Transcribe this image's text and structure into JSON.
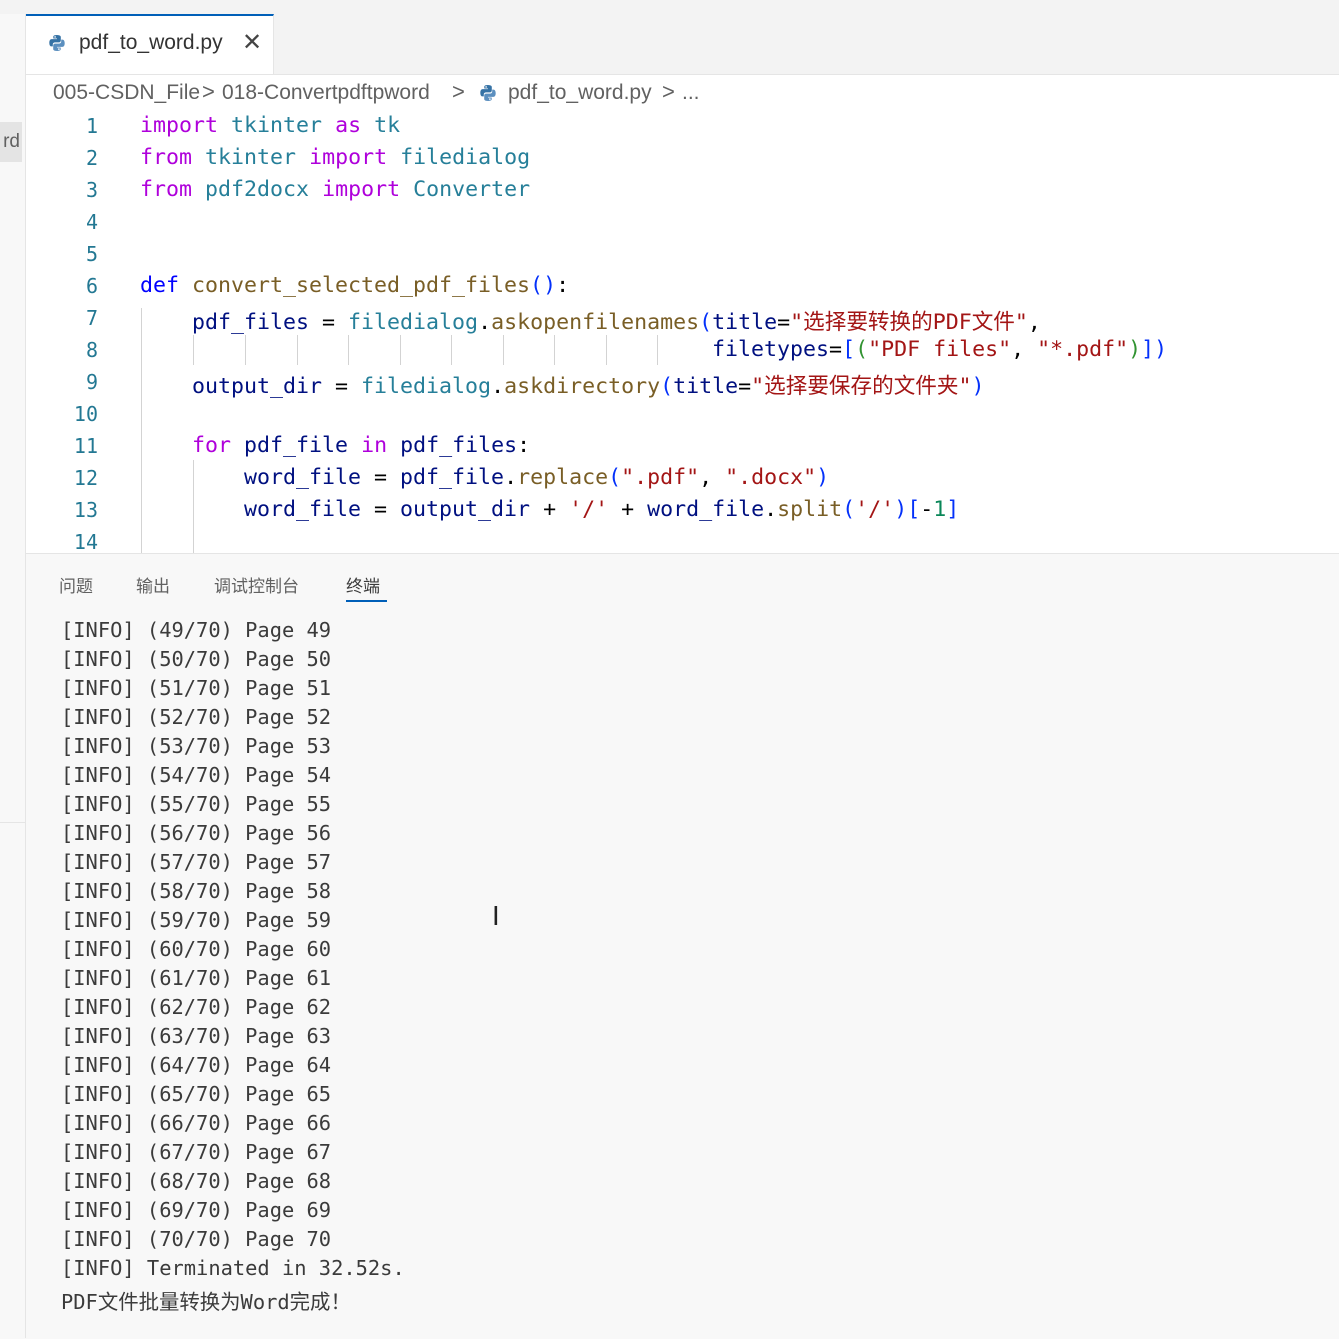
{
  "sidebar": {
    "fragment_text": "rd"
  },
  "tab": {
    "label": "pdf_to_word.py",
    "close": "✕",
    "icon": "python-icon"
  },
  "breadcrumb": {
    "items": [
      "005-CSDN_File",
      "018-Convertpdftpword",
      "pdf_to_word.py",
      "..."
    ],
    "separator": ">"
  },
  "editor": {
    "line_numbers": [
      "1",
      "2",
      "3",
      "4",
      "5",
      "6",
      "7",
      "8",
      "9",
      "10",
      "11",
      "12",
      "13",
      "14"
    ],
    "lines": [
      "import tkinter as tk",
      "from tkinter import filedialog",
      "from pdf2docx import Converter",
      "",
      "",
      "def convert_selected_pdf_files():",
      "    pdf_files = filedialog.askopenfilenames(title=\"选择要转换的PDF文件\",",
      "                                            filetypes=[(\"PDF files\", \"*.pdf\")])",
      "    output_dir = filedialog.askdirectory(title=\"选择要保存的文件夹\")",
      "",
      "    for pdf_file in pdf_files:",
      "        word_file = pdf_file.replace(\".pdf\", \".docx\")",
      "        word_file = output_dir + '/' + word_file.split('/')[-1]",
      ""
    ]
  },
  "panel": {
    "tabs": [
      "问题",
      "输出",
      "调试控制台",
      "终端"
    ],
    "active_tab": "终端",
    "terminal_lines": [
      "[INFO] (49/70) Page 49",
      "[INFO] (50/70) Page 50",
      "[INFO] (51/70) Page 51",
      "[INFO] (52/70) Page 52",
      "[INFO] (53/70) Page 53",
      "[INFO] (54/70) Page 54",
      "[INFO] (55/70) Page 55",
      "[INFO] (56/70) Page 56",
      "[INFO] (57/70) Page 57",
      "[INFO] (58/70) Page 58",
      "[INFO] (59/70) Page 59",
      "[INFO] (60/70) Page 60",
      "[INFO] (61/70) Page 61",
      "[INFO] (62/70) Page 62",
      "[INFO] (63/70) Page 63",
      "[INFO] (64/70) Page 64",
      "[INFO] (65/70) Page 65",
      "[INFO] (66/70) Page 66",
      "[INFO] (67/70) Page 67",
      "[INFO] (68/70) Page 68",
      "[INFO] (69/70) Page 69",
      "[INFO] (70/70) Page 70",
      "[INFO] Terminated in 32.52s.",
      "PDF文件批量转换为Word完成！"
    ]
  },
  "colors": {
    "accent": "#005fb8",
    "keyword": "#af00db",
    "def_keyword": "#0000ff",
    "module": "#267f99",
    "function": "#795e26",
    "variable": "#001080",
    "string": "#a31515",
    "number": "#098658",
    "line_number": "#237893"
  },
  "cursor": {
    "icon": "text-cursor-icon",
    "glyph": "I"
  }
}
